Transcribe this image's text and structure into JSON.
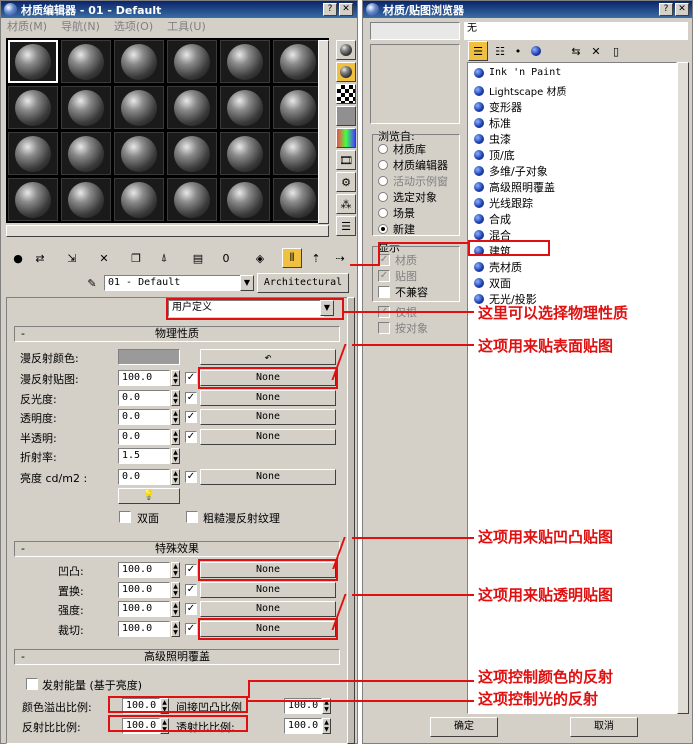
{
  "left_window": {
    "title": "材质编辑器 - 01 - Default",
    "menus": [
      "材质(M)",
      "导航(N)",
      "选项(O)",
      "工具(U)"
    ],
    "material_name": "01 - Default",
    "material_type": "Architectural",
    "template": "用户定义",
    "rollouts": {
      "physical": "物理性质",
      "special": "特殊效果",
      "advanced": "高级照明覆盖"
    },
    "physical_rows": [
      {
        "label": "漫反射颜色:",
        "value": "",
        "map": ""
      },
      {
        "label": "漫反射贴图:",
        "value": "100.0",
        "map": "None"
      },
      {
        "label": "反光度:",
        "value": "0.0",
        "map": "None"
      },
      {
        "label": "透明度:",
        "value": "0.0",
        "map": "None"
      },
      {
        "label": "半透明:",
        "value": "0.0",
        "map": "None"
      },
      {
        "label": "折射率:",
        "value": "1.5",
        "map": ""
      },
      {
        "label": "亮度 cd/m2 :",
        "value": "0.0",
        "map": "None"
      }
    ],
    "two_sided": "双面",
    "rough_diffuse": "粗糙漫反射纹理",
    "special_rows": [
      {
        "label": "凹凸:",
        "value": "100.0",
        "map": "None"
      },
      {
        "label": "置换:",
        "value": "100.0",
        "map": "None"
      },
      {
        "label": "强度:",
        "value": "100.0",
        "map": "None"
      },
      {
        "label": "裁切:",
        "value": "100.0",
        "map": "None"
      }
    ],
    "emit_energy": "发射能量 (基于亮度)",
    "color_bleed_label": "颜色溢出比例:",
    "color_bleed": "100.0",
    "indirect_bump_label": "间接凹凸比例",
    "indirect_bump": "100.0",
    "reflectance_label": "反射比比例:",
    "reflectance": "100.0",
    "transmittance_label": "透射比比例:",
    "transmittance": "100.0"
  },
  "right_window": {
    "title": "材质/贴图浏览器",
    "name_field": "无",
    "browse_from_label": "浏览自:",
    "browse_from": [
      "材质库",
      "材质编辑器",
      "活动示例窗",
      "选定对象",
      "场景",
      "新建"
    ],
    "show_label": "显示",
    "show": [
      "材质",
      "贴图",
      "不兼容"
    ],
    "root_only": "仅根",
    "by_object": "按对象",
    "list": [
      "Ink 'n Paint",
      "Lightscape 材质",
      "变形器",
      "标准",
      "虫漆",
      "顶/底",
      "多维/子对象",
      "高级照明覆盖",
      "光线跟踪",
      "合成",
      "混合",
      "建筑",
      "壳材质",
      "双面",
      "无光/投影"
    ],
    "ok": "确定",
    "cancel": "取消"
  },
  "annotations": [
    "这里可以选择物理性质",
    "这项用来贴表面贴图",
    "这项用来贴凹凸贴图",
    "这项用来贴透明贴图",
    "这项控制颜色的反射",
    "这项控制光的反射"
  ],
  "accent_red": "#e01010"
}
